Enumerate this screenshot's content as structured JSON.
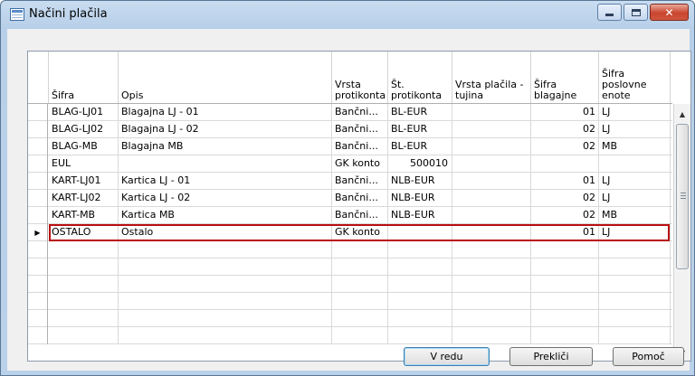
{
  "window": {
    "title": "Načini plačila"
  },
  "grid": {
    "headers": {
      "code": "Šifra",
      "description": "Opis",
      "bal_account_type": "Vrsta protikonta",
      "bal_account_no": "Št. protikonta",
      "foreign_payment_type": "Vrsta plačila - tujina",
      "cashier_code": "Šifra blagajne",
      "business_unit_code": "Šifra poslovne enote"
    },
    "rows": [
      {
        "code": "BLAG-LJ01",
        "description": "Blagajna LJ - 01",
        "bal_account_type": "Bančni...",
        "bal_account_no": "BL-EUR",
        "foreign_payment_type": "",
        "cashier_code": "01",
        "business_unit_code": "LJ"
      },
      {
        "code": "BLAG-LJ02",
        "description": "Blagajna LJ - 02",
        "bal_account_type": "Bančni...",
        "bal_account_no": "BL-EUR",
        "foreign_payment_type": "",
        "cashier_code": "02",
        "business_unit_code": "LJ"
      },
      {
        "code": "BLAG-MB",
        "description": "Blagajna MB",
        "bal_account_type": "Bančni...",
        "bal_account_no": "BL-EUR",
        "foreign_payment_type": "",
        "cashier_code": "02",
        "business_unit_code": "MB"
      },
      {
        "code": "EUL",
        "description": "",
        "bal_account_type": "GK konto",
        "bal_account_no": "500010",
        "foreign_payment_type": "",
        "cashier_code": "",
        "business_unit_code": ""
      },
      {
        "code": "KART-LJ01",
        "description": "Kartica LJ - 01",
        "bal_account_type": "Bančni...",
        "bal_account_no": "NLB-EUR",
        "foreign_payment_type": "",
        "cashier_code": "01",
        "business_unit_code": "LJ"
      },
      {
        "code": "KART-LJ02",
        "description": "Kartica LJ - 02",
        "bal_account_type": "Bančni...",
        "bal_account_no": "NLB-EUR",
        "foreign_payment_type": "",
        "cashier_code": "02",
        "business_unit_code": "LJ"
      },
      {
        "code": "KART-MB",
        "description": "Kartica MB",
        "bal_account_type": "Bančni...",
        "bal_account_no": "NLB-EUR",
        "foreign_payment_type": "",
        "cashier_code": "02",
        "business_unit_code": "MB"
      },
      {
        "code": "OSTALO",
        "description": "Ostalo",
        "bal_account_type": "GK konto",
        "bal_account_no": "",
        "foreign_payment_type": "",
        "cashier_code": "01",
        "business_unit_code": "LJ"
      }
    ],
    "selected_row_marker": "▶",
    "selected_row_index": 7
  },
  "buttons": {
    "ok": "V redu",
    "cancel": "Prekliči",
    "help": "Pomoč"
  },
  "icons": {
    "app": "form-icon",
    "minimize": "minimize-icon",
    "maximize": "maximize-icon",
    "close": "close-icon",
    "scroll_up": "scroll-up-arrow-icon",
    "scroll_down": "scroll-down-arrow-icon"
  },
  "colors": {
    "selection_border": "#b80f12",
    "close_button": "#c9452f"
  }
}
